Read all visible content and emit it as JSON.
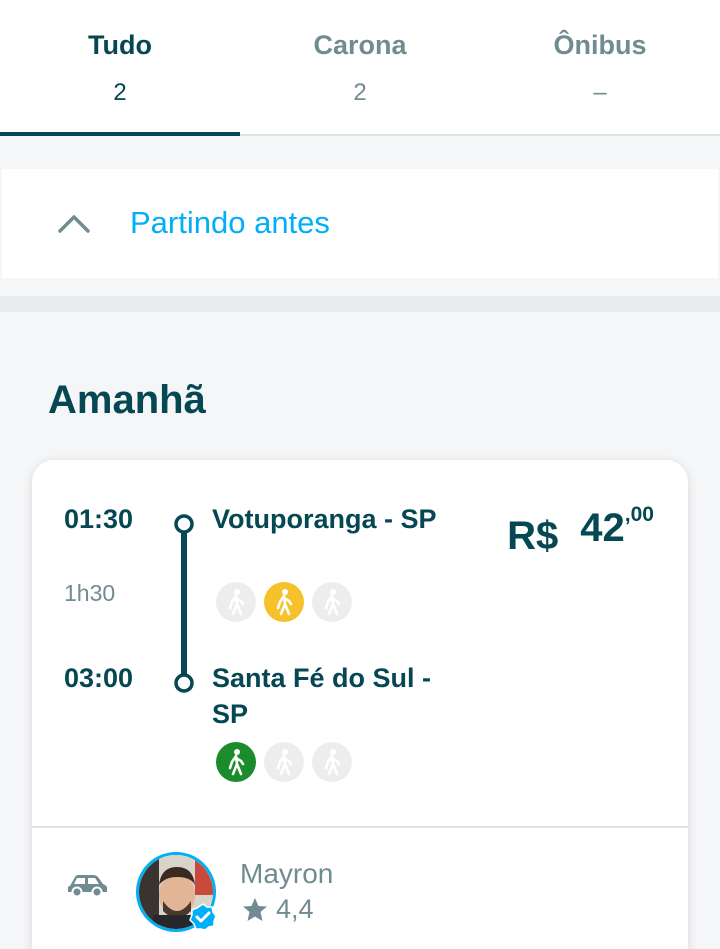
{
  "tabs": [
    {
      "title": "Tudo",
      "count": "2"
    },
    {
      "title": "Carona",
      "count": "2"
    },
    {
      "title": "Ônibus",
      "count": "–"
    }
  ],
  "earlier": {
    "label": "Partindo antes",
    "icon": "chevron-up-icon"
  },
  "date_header": "Amanhã",
  "trip": {
    "departure_time": "01:30",
    "duration": "1h30",
    "arrival_time": "03:00",
    "origin": "Votuporanga - SP",
    "destination": "Santa Fé do Sul - SP",
    "price": {
      "currency": "R$",
      "integer": "42",
      "decimal": ",00"
    },
    "origin_proximity": [
      "grey",
      "yellow",
      "grey"
    ],
    "destination_proximity": [
      "green",
      "grey",
      "grey"
    ],
    "driver": {
      "name": "Mayron",
      "rating": "4,4"
    }
  },
  "colors": {
    "primary": "#054752",
    "accent": "#00aff5",
    "muted": "#708c91",
    "walk_green": "#1c8b2b",
    "walk_yellow": "#f7c12c"
  }
}
